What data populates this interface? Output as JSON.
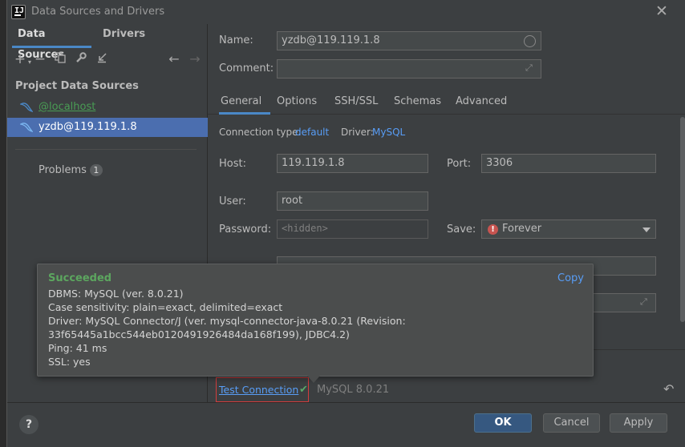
{
  "window": {
    "title": "Data Sources and Drivers"
  },
  "left_panel": {
    "tabs": [
      "Data Sources",
      "Drivers"
    ],
    "section_title": "Project Data Sources",
    "items": [
      {
        "label": "@localhost"
      },
      {
        "label": "yzdb@119.119.1.8"
      }
    ],
    "problems": {
      "label": "Problems",
      "count": "1"
    }
  },
  "form": {
    "name_label": "Name:",
    "name_value": "yzdb@119.119.1.8",
    "comment_label": "Comment:",
    "comment_value": "",
    "tabs": [
      "General",
      "Options",
      "SSH/SSL",
      "Schemas",
      "Advanced"
    ],
    "connection_type_label": "Connection type:",
    "connection_type_value": "default",
    "driver_label": "Driver:",
    "driver_value": "MySQL",
    "host_label": "Host:",
    "host_value": "119.119.1.8",
    "port_label": "Port:",
    "port_value": "3306",
    "user_label": "User:",
    "user_value": "root",
    "password_label": "Password:",
    "password_placeholder": "<hidden>",
    "save_label": "Save:",
    "save_value": "Forever"
  },
  "popup": {
    "title": "Succeeded",
    "copy_label": "Copy",
    "lines": [
      "DBMS: MySQL (ver. 8.0.21)",
      "Case sensitivity: plain=exact, delimited=exact",
      "Driver: MySQL Connector/J (ver. mysql-connector-java-8.0.21 (Revision:",
      "33f65445a1bcc544eb0120491926484da168f199), JDBC4.2)",
      "Ping: 41 ms",
      "SSL: yes"
    ]
  },
  "test": {
    "link_label": "Test Connection",
    "version": "MySQL 8.0.21"
  },
  "buttons": {
    "help": "?",
    "ok": "OK",
    "cancel": "Cancel",
    "apply": "Apply"
  },
  "colors": {
    "accent": "#4a88c7",
    "selection": "#4b6eaf",
    "success": "#5ca65f",
    "link": "#589df6",
    "highlight_box": "#d23d3d"
  }
}
